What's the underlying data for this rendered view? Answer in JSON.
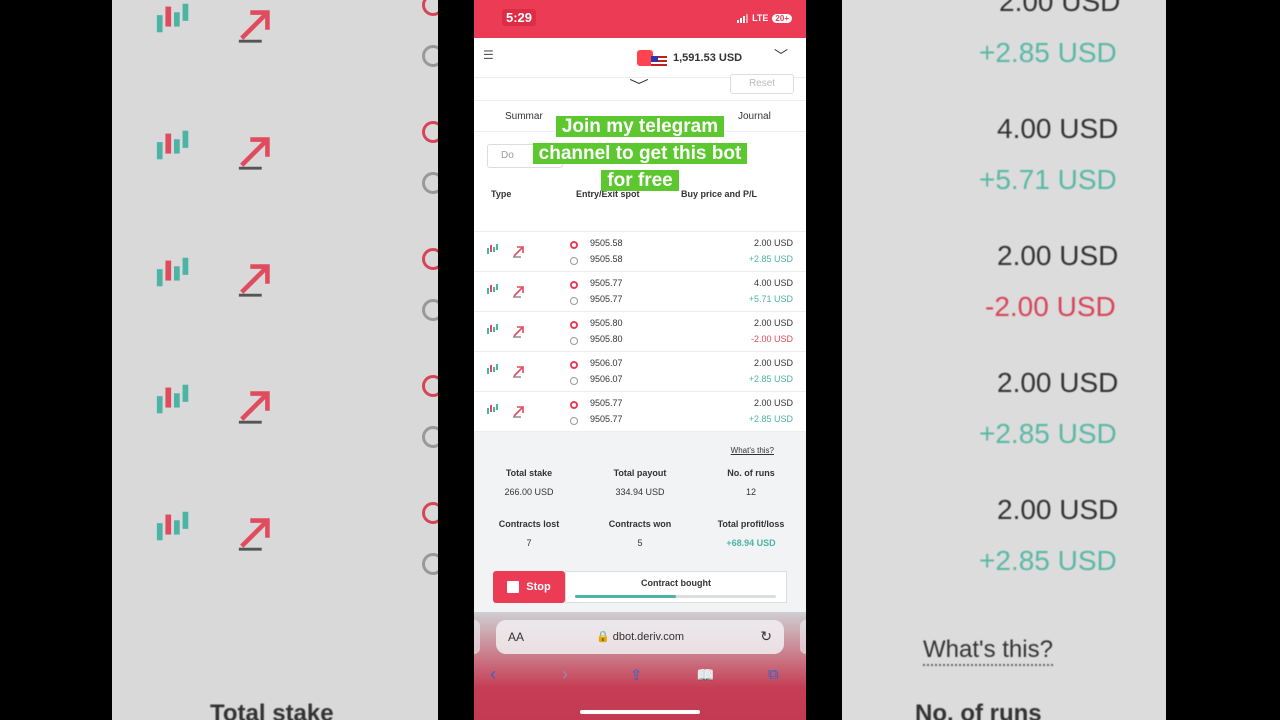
{
  "status": {
    "time": "5:29",
    "network": "LTE",
    "badge": "20+"
  },
  "account": {
    "balance": "1,591.53 USD"
  },
  "toolbar": {
    "reset_label": "Reset"
  },
  "tabs": [
    "Summar",
    "Journal"
  ],
  "download_label": "Do",
  "overlay": {
    "lines": [
      "Join my telegram",
      "channel to get this bot",
      "for free"
    ]
  },
  "table": {
    "headers": {
      "type": "Type",
      "entry_exit": "Entry/Exit spot",
      "buy_pl": "Buy price and P/L"
    },
    "rows": [
      {
        "entry": "9505.58",
        "exit": "9505.58",
        "buy": "2.00 USD",
        "pl": "+2.85 USD",
        "pl_sign": "pos"
      },
      {
        "entry": "9505.77",
        "exit": "9505.77",
        "buy": "4.00 USD",
        "pl": "+5.71 USD",
        "pl_sign": "pos"
      },
      {
        "entry": "9505.80",
        "exit": "9505.80",
        "buy": "2.00 USD",
        "pl": "-2.00 USD",
        "pl_sign": "neg"
      },
      {
        "entry": "9506.07",
        "exit": "9506.07",
        "buy": "2.00 USD",
        "pl": "+2.85 USD",
        "pl_sign": "pos"
      },
      {
        "entry": "9505.77",
        "exit": "9505.77",
        "buy": "2.00 USD",
        "pl": "+2.85 USD",
        "pl_sign": "pos"
      }
    ]
  },
  "summary": {
    "whats_this": "What's this?",
    "total_stake_label": "Total stake",
    "total_stake": "266.00 USD",
    "total_payout_label": "Total payout",
    "total_payout": "334.94 USD",
    "runs_label": "No. of runs",
    "runs": "12",
    "lost_label": "Contracts lost",
    "lost": "7",
    "won_label": "Contracts won",
    "won": "5",
    "profit_label": "Total profit/loss",
    "profit": "+68.94 USD"
  },
  "controls": {
    "stop_label": "Stop",
    "contract_status": "Contract bought",
    "progress": 0.5
  },
  "browser": {
    "aa": "AA",
    "url": "dbot.deriv.com"
  },
  "backdrop": {
    "right_values": [
      "2.00 USD",
      "+2.85 USD",
      "4.00 USD",
      "+5.71 USD",
      "2.00 USD",
      "-2.00 USD",
      "2.00 USD",
      "+2.85 USD",
      "2.00 USD",
      "+2.85 USD"
    ],
    "whats_this": "What's this?",
    "total_stake": "Total stake",
    "runs": "No. of runs"
  },
  "colors": {
    "brand": "#ec3c55",
    "profit": "#4bb4a4",
    "loss": "#e04b5e",
    "overlay": "#5cc72e"
  }
}
